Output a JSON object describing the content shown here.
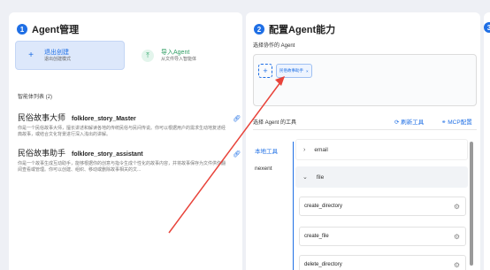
{
  "panel1": {
    "step": "1",
    "title": "Agent管理",
    "create": {
      "title": "退出创建",
      "subtitle": "退出创建模式"
    },
    "import": {
      "title": "导入Agent",
      "subtitle": "从文件导入智能体"
    },
    "list_label": "智能体列表 (2)",
    "agents": [
      {
        "name_cn": "民俗故事大师",
        "name_en": "folklore_story_Master",
        "desc": "你是一个民俗故事大师，擅长讲述和解读各地的传统民俗与民间传说。你可以根据用户的需求生动地复述经典故事，或结合文化背景进行深入浅出的讲解。"
      },
      {
        "name_cn": "民俗故事助手",
        "name_en": "folklore_story_assistant",
        "desc": "你是一个故事生成互动助手，能够根据你的创意与指令生成个性化的故事内容，并将故事保存为文件供你翻阅查看或管理。你可以创建、组织、移动或删除故事相关的文..."
      }
    ]
  },
  "panel2": {
    "step": "2",
    "title": "配置Agent能力",
    "collab_label": "选择协作的 Agent",
    "collab_tag": "民俗故事助手",
    "tools_label": "选择 Agent 的工具",
    "refresh": "刷新工具",
    "mcp": "MCP配置",
    "tabs": [
      "本地工具",
      "nexent"
    ],
    "tool_groups": [
      "email",
      "file"
    ],
    "file_tools": [
      "create_directory",
      "create_file",
      "delete_directory"
    ]
  },
  "panel3": {
    "step": "3"
  },
  "colors": {
    "accent": "#1f6fe5",
    "arrow": "#e8433a",
    "import_green": "#2ea66a"
  }
}
